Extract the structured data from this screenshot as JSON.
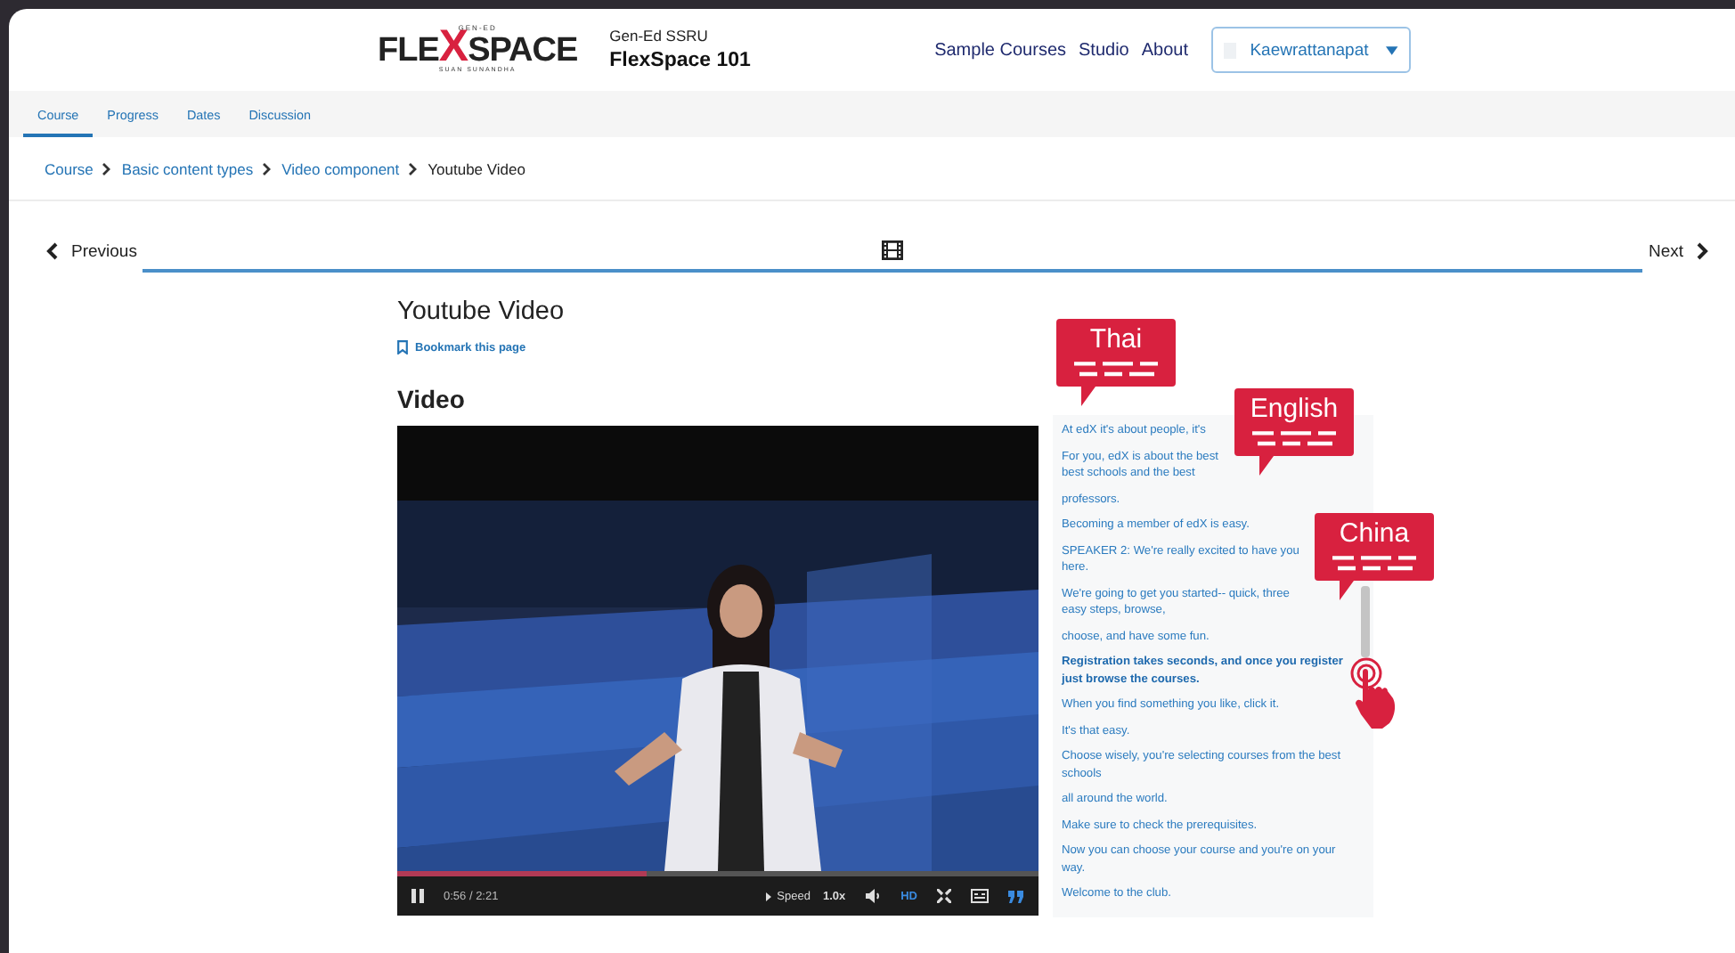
{
  "header": {
    "logo": {
      "top": "GEN-ED",
      "pre": "FLE",
      "mark": "X",
      "post": "SPACE",
      "bottom": "SUAN SUNANDHA"
    },
    "org": "Gen-Ed SSRU",
    "course": "FlexSpace 101",
    "nav": [
      "Sample Courses",
      "Studio",
      "About"
    ],
    "user": "Kaewrattanapat"
  },
  "tabs": [
    {
      "label": "Course",
      "selected": true
    },
    {
      "label": "Progress",
      "selected": false
    },
    {
      "label": "Dates",
      "selected": false
    },
    {
      "label": "Discussion",
      "selected": false
    }
  ],
  "breadcrumb": [
    "Course",
    "Basic content types",
    "Video component",
    "Youtube Video"
  ],
  "sequence": {
    "previous": "Previous",
    "next": "Next"
  },
  "unit": {
    "title": "Youtube Video",
    "bookmark": "Bookmark this page",
    "heading": "Video"
  },
  "player": {
    "kind": "picture",
    "time": "0:56 / 2:21",
    "speed_label": "Speed",
    "speed": "1.0x",
    "hd": "HD",
    "level": 0.39
  },
  "transcript": [
    {
      "text": "At edX it's about people, it's",
      "active": false
    },
    {
      "text": "For you, edX is about the best",
      "active": false
    },
    {
      "text": "best schools and the best",
      "active": false
    },
    {
      "text": "professors.",
      "active": false
    },
    {
      "text": "Becoming a member of edX is easy.",
      "active": false
    },
    {
      "text": "SPEAKER 2: We're really excited to have you",
      "active": false
    },
    {
      "text": "here.",
      "active": false
    },
    {
      "text": "We're going to get you started-- quick, three",
      "active": false
    },
    {
      "text": "easy steps, browse,",
      "active": false
    },
    {
      "text": "choose, and have some fun.",
      "active": false
    },
    {
      "text": "Registration takes seconds, and once you register just browse the courses.",
      "active": true
    },
    {
      "text": "When you find something you like, click it.",
      "active": false
    },
    {
      "text": "It's that easy.",
      "active": false
    },
    {
      "text": "Choose wisely, you're selecting courses from the best schools",
      "active": false
    },
    {
      "text": "all around the world.",
      "active": false
    },
    {
      "text": "Make sure to check the prerequisites.",
      "active": false
    },
    {
      "text": "Now you can choose your course and you're on your way.",
      "active": false
    },
    {
      "text": "Welcome to the club.",
      "active": false
    }
  ],
  "callouts": [
    {
      "label": "Thai"
    },
    {
      "label": "English"
    },
    {
      "label": "China"
    }
  ]
}
